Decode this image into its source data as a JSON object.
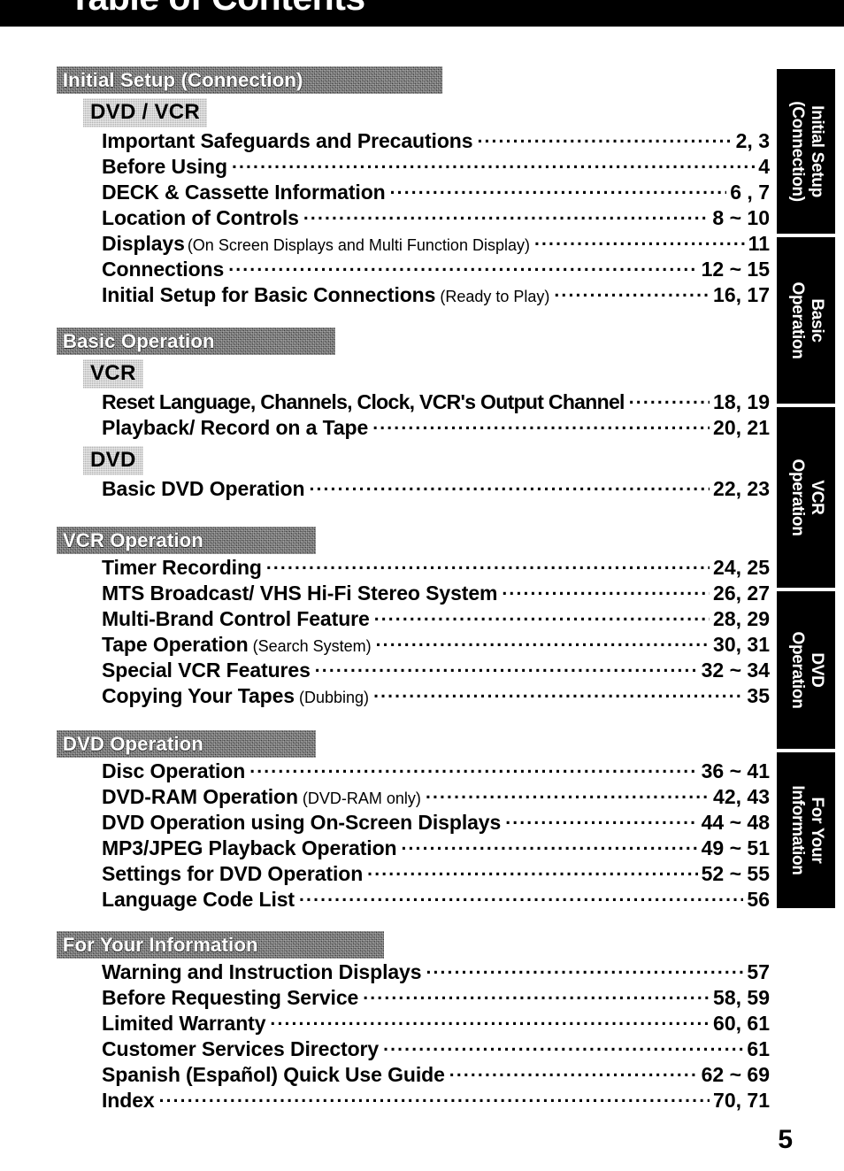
{
  "header": {
    "title": "Table of Contents"
  },
  "footer": {
    "page_number": "5"
  },
  "side_tabs": [
    {
      "label": "Initial Setup\n(Connection)"
    },
    {
      "label": "Basic\nOperation"
    },
    {
      "label": "VCR\nOperation"
    },
    {
      "label": "DVD\nOperation"
    },
    {
      "label": "For Your\nInformation"
    }
  ],
  "sections": [
    {
      "title": "Initial Setup (Connection)",
      "groups": [
        {
          "badge": "DVD / VCR",
          "entries": [
            {
              "title": "Important Safeguards and Precautions",
              "note": "",
              "pages": "2, 3"
            },
            {
              "title": "Before Using",
              "note": "",
              "pages": "4"
            },
            {
              "title": "DECK & Cassette Information",
              "note": "",
              "pages": "6 , 7"
            },
            {
              "title": "Location of Controls",
              "note": "",
              "pages": "8 ~ 10"
            },
            {
              "title": "Displays",
              "note": "(On Screen Displays and Multi Function Display)",
              "pages": "11"
            },
            {
              "title": "Connections",
              "note": "",
              "pages": "12 ~ 15"
            },
            {
              "title": "Initial Setup for Basic Connections",
              "note": "(Ready to Play)",
              "pages": "16, 17"
            }
          ]
        }
      ]
    },
    {
      "title": "Basic Operation",
      "groups": [
        {
          "badge": "VCR",
          "entries": [
            {
              "title": "Reset Language, Channels, Clock, VCR's Output Channel",
              "note": "",
              "pages": "18, 19"
            },
            {
              "title": "Playback/ Record on a Tape",
              "note": "",
              "pages": "20, 21"
            }
          ]
        },
        {
          "badge": "DVD",
          "entries": [
            {
              "title": "Basic DVD Operation",
              "note": "",
              "pages": "22, 23"
            }
          ]
        }
      ]
    },
    {
      "title": "VCR Operation",
      "groups": [
        {
          "badge": "",
          "entries": [
            {
              "title": "Timer Recording",
              "note": "",
              "pages": "24, 25"
            },
            {
              "title": "MTS Broadcast/ VHS Hi-Fi Stereo System",
              "note": "",
              "pages": "26, 27"
            },
            {
              "title": "Multi-Brand Control Feature",
              "note": "",
              "pages": "28, 29"
            },
            {
              "title": "Tape Operation",
              "note": "(Search System)",
              "pages": "30, 31"
            },
            {
              "title": "Special VCR Features",
              "note": "",
              "pages": "32 ~ 34"
            },
            {
              "title": "Copying Your Tapes",
              "note": "(Dubbing)",
              "pages": "35"
            }
          ]
        }
      ]
    },
    {
      "title": "DVD Operation",
      "groups": [
        {
          "badge": "",
          "entries": [
            {
              "title": "Disc Operation",
              "note": "",
              "pages": "36 ~ 41"
            },
            {
              "title": "DVD-RAM Operation",
              "note": "(DVD-RAM only)",
              "pages": "42, 43"
            },
            {
              "title": "DVD Operation using On-Screen Displays",
              "note": "",
              "pages": "44 ~ 48"
            },
            {
              "title": "MP3/JPEG Playback Operation",
              "note": "",
              "pages": "49 ~ 51"
            },
            {
              "title": "Settings for DVD Operation",
              "note": "",
              "pages": "52 ~ 55"
            },
            {
              "title": "Language Code List",
              "note": "",
              "pages": "56"
            }
          ]
        }
      ]
    },
    {
      "title": "For Your Information",
      "groups": [
        {
          "badge": "",
          "entries": [
            {
              "title": "Warning and Instruction Displays",
              "note": "",
              "pages": "57"
            },
            {
              "title": "Before Requesting Service",
              "note": "",
              "pages": "58, 59"
            },
            {
              "title": "Limited Warranty",
              "note": "",
              "pages": "60, 61"
            },
            {
              "title": "Customer Services Directory",
              "note": "",
              "pages": "61"
            },
            {
              "title": "Spanish (Español) Quick Use Guide",
              "note": "",
              "pages": "62 ~ 69"
            },
            {
              "title": "Index",
              "note": "",
              "pages": "70, 71"
            }
          ]
        }
      ]
    }
  ]
}
